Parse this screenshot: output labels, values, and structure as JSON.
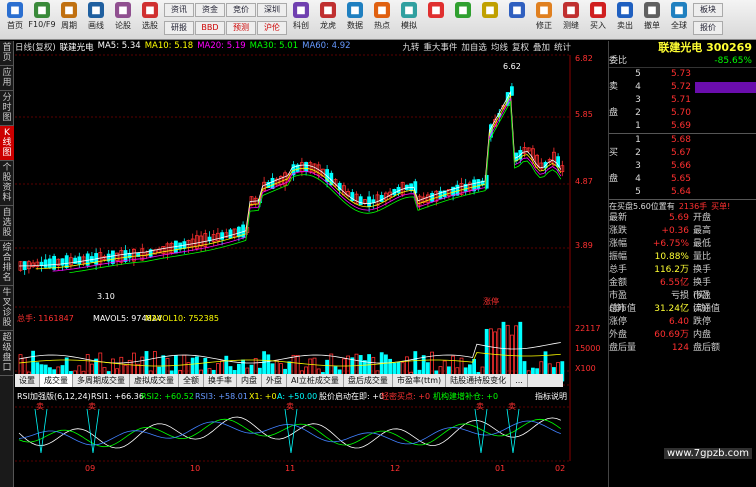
{
  "toolbar": {
    "buttons": [
      {
        "label": "首页",
        "icon": "home-icon",
        "color": "#2b6fd0"
      },
      {
        "label": "F10/F9",
        "icon": "f10-icon",
        "color": "#3a8a3a"
      },
      {
        "label": "周期",
        "icon": "period-icon",
        "color": "#c07010"
      },
      {
        "label": "画线",
        "icon": "draw-line-icon",
        "color": "#2060a0"
      },
      {
        "label": "论股",
        "icon": "discuss-icon",
        "color": "#905090"
      },
      {
        "label": "选股",
        "icon": "stock-pick-icon",
        "color": "#d03030"
      }
    ],
    "groups": [
      [
        "资讯",
        "研报"
      ],
      [
        "资金",
        "BBD"
      ],
      [
        "竞价",
        "预测"
      ],
      [
        "深圳",
        "沪伦"
      ]
    ],
    "buttons2": [
      {
        "label": "科创",
        "icon": "kechuang-icon",
        "color": "#7040b0"
      },
      {
        "label": "龙虎",
        "icon": "dragon-tiger-icon",
        "color": "#c03030"
      },
      {
        "label": "数据",
        "icon": "data-icon",
        "color": "#2080c0"
      },
      {
        "label": "热点",
        "icon": "hot-icon",
        "color": "#e06010"
      },
      {
        "label": "模拟",
        "icon": "simulate-icon",
        "color": "#30a0a0"
      }
    ],
    "nav": [
      {
        "label": "",
        "icon": "arrow-left-icon"
      },
      {
        "label": "",
        "icon": "arrow-right-icon"
      },
      {
        "label": "",
        "icon": "arrow-up-icon"
      },
      {
        "label": "",
        "icon": "arrow-down-icon"
      },
      {
        "label": "修正",
        "icon": "fix-icon"
      },
      {
        "label": "测缝",
        "icon": "measure-icon"
      },
      {
        "label": "买入",
        "icon": "buy-icon"
      },
      {
        "label": "卖出",
        "icon": "sell-icon"
      },
      {
        "label": "撤单",
        "icon": "cancel-order-icon"
      },
      {
        "label": "全球",
        "icon": "globe-icon"
      }
    ],
    "right_group": [
      "板块",
      "报价"
    ]
  },
  "left_tabs": [
    "首页",
    "应用",
    "分时图",
    "K线图",
    "个股资料",
    "自选股",
    "综合排名",
    "牛叉诊股",
    "超级盘口"
  ],
  "header": {
    "title": "日线(复权)",
    "stock": "联建光电",
    "ma5": "MA5: 5.34",
    "ma10": "MA10: 5.18",
    "ma20": "MA20: 5.19",
    "ma30": "MA30: 5.01",
    "ma60": "MA60: 4.92",
    "links": [
      "九转",
      "重大事件",
      "加自选",
      "均线",
      "复权",
      "叠加",
      "统计"
    ]
  },
  "price_axis": [
    "6.82",
    "5.85",
    "4.87",
    "3.89"
  ],
  "annotations": {
    "high": "6.62",
    "low": "3.10",
    "tag": "涨停"
  },
  "volume": {
    "header": "总手: 1161847",
    "mavol5": "MAVOL5: 974824",
    "mavol10": "MAVOL10: 752385",
    "axis": [
      "22117",
      "15000",
      "X100"
    ]
  },
  "tabs": [
    "设置",
    "成交量",
    "多周期成交量",
    "虚拟成交量",
    "全额",
    "换手率",
    "内盘",
    "外盘",
    "AI立桩成交量",
    "盘后成交量",
    "市盈率(ttm)",
    "陆股通持股变化",
    "..."
  ],
  "rsi": {
    "title": "RSI加强版(6,12,24)",
    "rsi1": "RSI1: +66.36",
    "rsi2": "RSI2: +60.52",
    "rsi3": "RSI3: +58.01",
    "x1": "X1: +0",
    "a": "A: +50.00",
    "s1": "股价启动在即: +0",
    "s2": "轻密买点: +0",
    "s3": "机构建增补仓: +0",
    "help": "指标说明",
    "sell_marks": [
      "卖",
      "卖",
      "卖",
      "卖",
      "卖"
    ]
  },
  "date_axis": [
    "09",
    "10",
    "11",
    "12",
    "01",
    "02"
  ],
  "right_panel": {
    "name": "联建光电",
    "code": "300269",
    "weibi_label": "委比",
    "weibi": "-85.65%",
    "sell_label": "卖",
    "sell_label2": "盘",
    "buy_label": "买",
    "buy_label2": "盘",
    "sells": [
      {
        "n": "5",
        "p": "5.73"
      },
      {
        "n": "4",
        "p": "5.72"
      },
      {
        "n": "3",
        "p": "5.71"
      },
      {
        "n": "2",
        "p": "5.70"
      },
      {
        "n": "1",
        "p": "5.69"
      }
    ],
    "buys": [
      {
        "n": "1",
        "p": "5.68"
      },
      {
        "n": "2",
        "p": "5.67"
      },
      {
        "n": "3",
        "p": "5.66"
      },
      {
        "n": "4",
        "p": "5.65"
      },
      {
        "n": "5",
        "p": "5.64"
      }
    ],
    "status": "在买盘5.60位置有",
    "status_val": "2136手",
    "status_tag": "买单!",
    "stats": [
      [
        "最新",
        "5.69",
        "开盘",
        ""
      ],
      [
        "涨跌",
        "+0.36",
        "最高",
        ""
      ],
      [
        "涨幅",
        "+6.75%",
        "最低",
        ""
      ],
      [
        "振幅",
        "10.88%",
        "量比",
        ""
      ],
      [
        "总手",
        "116.2万",
        "换手",
        ""
      ],
      [
        "金额",
        "6.55亿",
        "换手(实)",
        ""
      ],
      [
        "市盈(静)",
        "亏损",
        "市盈(动)",
        ""
      ],
      [
        "总市值",
        "31.24亿",
        "流通值",
        ""
      ],
      [
        "涨停",
        "6.40",
        "跌停",
        ""
      ],
      [
        "外盘",
        "60.69万",
        "内盘",
        ""
      ],
      [
        "盘后量",
        "124",
        "盘后额",
        ""
      ]
    ]
  },
  "watermark": "www.7gpzb.com",
  "colors": {
    "up": "#ff3030",
    "down": "#00ffff",
    "ma5": "#ffffff",
    "ma10": "#ffff00",
    "ma20": "#ff00ff",
    "ma30": "#00ff00",
    "ma60": "#4080ff"
  }
}
